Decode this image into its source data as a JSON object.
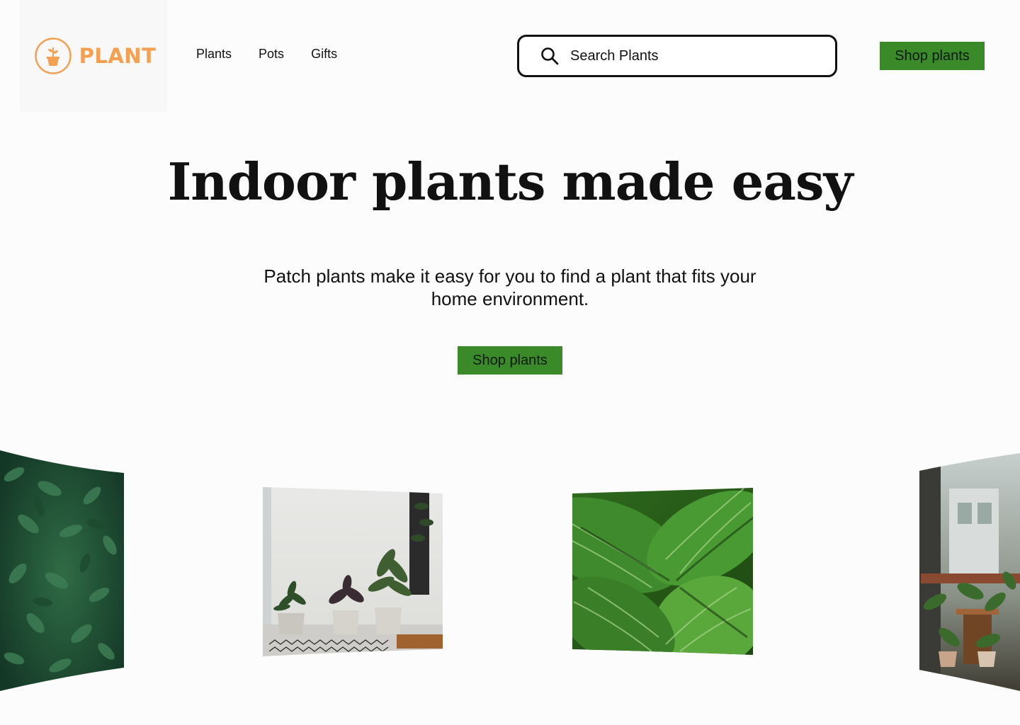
{
  "header": {
    "logo_text": "PLANT",
    "nav": [
      "Plants",
      "Pots",
      "Gifts"
    ],
    "search_placeholder": "Search Plants",
    "cta_label": "Shop plants"
  },
  "hero": {
    "title": "Indoor plants made easy",
    "subtitle": "Patch plants make it easy for you to find a plant that fits your home environment.",
    "cta_label": "Shop plants"
  },
  "colors": {
    "brand_orange": "#f5a050",
    "cta_green": "#3a8a2a",
    "background": "#fcfcfc"
  },
  "icons": {
    "logo": "plant-pot-icon",
    "search": "search-icon"
  },
  "gallery": {
    "images": [
      "leafy-wall-photo",
      "potted-plants-room-photo",
      "calathea-leaves-photo",
      "cafe-plants-photo"
    ]
  }
}
